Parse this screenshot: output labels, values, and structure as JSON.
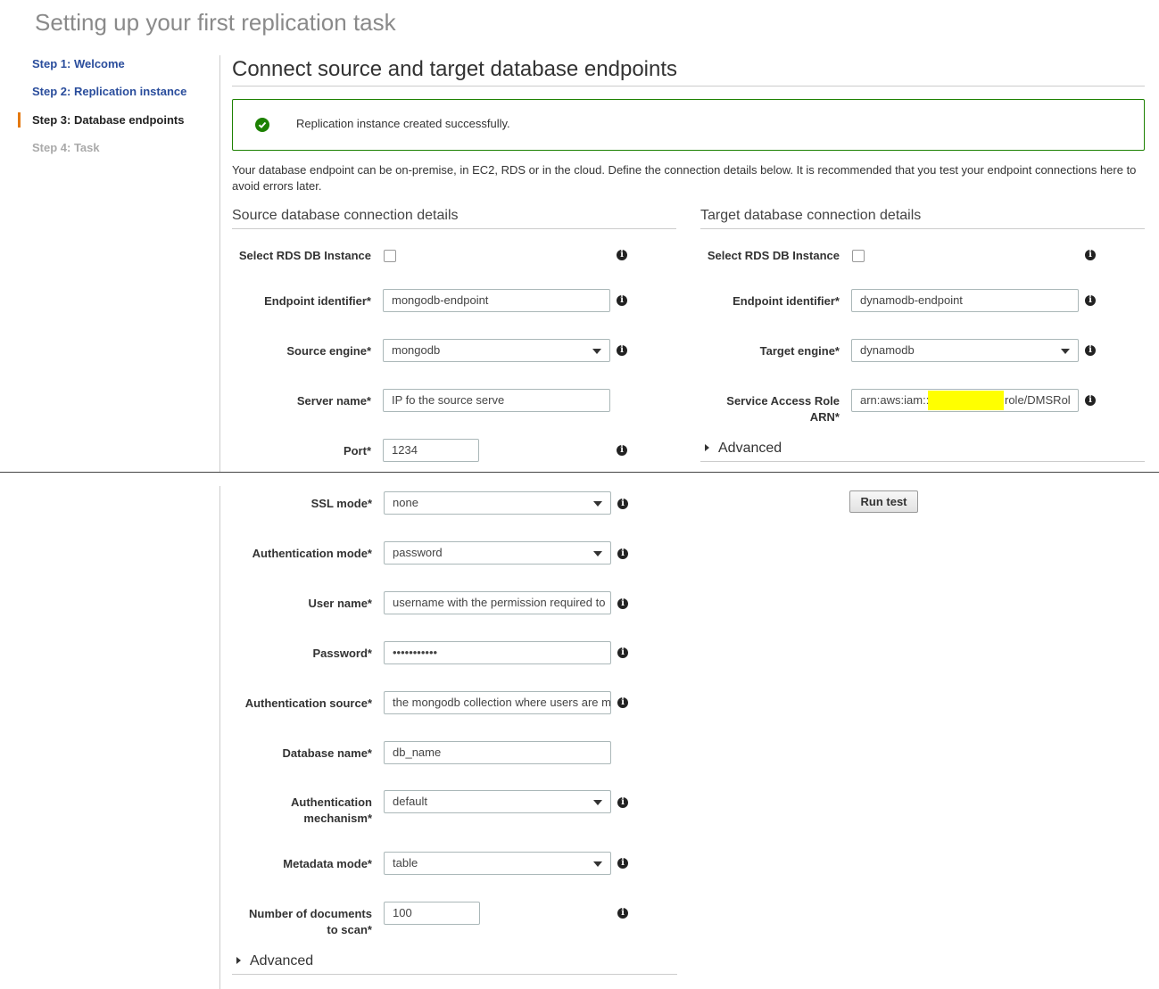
{
  "page_title": "Setting up your first replication task",
  "steps": [
    {
      "label": "Step 1: Welcome",
      "state": "link"
    },
    {
      "label": "Step 2: Replication instance",
      "state": "link"
    },
    {
      "label": "Step 3: Database endpoints",
      "state": "active"
    },
    {
      "label": "Step 4: Task",
      "state": "disabled"
    }
  ],
  "heading": "Connect source and target database endpoints",
  "banner": {
    "icon": "check-circle-icon",
    "color": "#1d8102",
    "text": "Replication instance created successfully."
  },
  "description": "Your database endpoint can be on-premise, in EC2, RDS or in the cloud. Define the connection details below. It is recommended that you test your endpoint connections here to avoid errors later.",
  "source": {
    "title": "Source database connection details",
    "select_rds_label": "Select RDS DB Instance",
    "endpoint_id_label": "Endpoint identifier*",
    "endpoint_id_value": "mongodb-endpoint",
    "engine_label": "Source engine*",
    "engine_value": "mongodb",
    "server_label": "Server name*",
    "server_value": "IP fo the source serve",
    "port_label": "Port*",
    "port_value": "1234",
    "ssl_label": "SSL mode*",
    "ssl_value": "none",
    "auth_mode_label": "Authentication mode*",
    "auth_mode_value": "password",
    "username_label": "User name*",
    "username_value": "username with the permission required to",
    "password_label": "Password*",
    "password_value": "•••••••••••",
    "auth_source_label": "Authentication source*",
    "auth_source_value": "the mongodb collection where users are m",
    "db_name_label": "Database name*",
    "db_name_value": "db_name",
    "auth_mech_label_1": "Authentication",
    "auth_mech_label_2": "mechanism*",
    "auth_mech_value": "default",
    "metadata_label": "Metadata mode*",
    "metadata_value": "table",
    "docs_label_1": "Number of documents",
    "docs_label_2": "to scan*",
    "docs_value": "100",
    "advanced": "Advanced"
  },
  "target": {
    "title": "Target database connection details",
    "select_rds_label": "Select RDS DB Instance",
    "endpoint_id_label": "Endpoint identifier*",
    "endpoint_id_value": "dynamodb-endpoint",
    "engine_label": "Target engine*",
    "engine_value": "dynamodb",
    "arn_label_1": "Service Access Role",
    "arn_label_2": "ARN*",
    "arn_prefix": "arn:aws:iam::",
    "arn_suffix": "role/DMSRol",
    "advanced": "Advanced"
  },
  "run_test": "Run test",
  "info_glyph": "i"
}
